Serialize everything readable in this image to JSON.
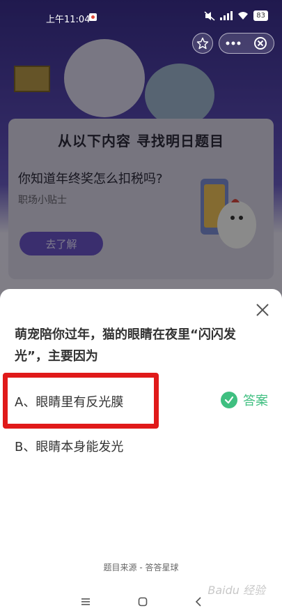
{
  "status": {
    "time": "上午11:04",
    "battery": "83"
  },
  "background": {
    "card_title": "从以下内容 寻找明日题目",
    "tip_question": "你知道年终奖怎么扣税吗?",
    "tip_subtitle": "职场小贴士",
    "learn_button": "去了解"
  },
  "question": {
    "text": "萌宠陪你过年，猫的眼睛在夜里“闪闪发光”，主要因为",
    "option_a": "A、眼睛里有反光膜",
    "option_b": "B、眼睛本身能发光",
    "answer_label": "答案"
  },
  "footer": {
    "source": "题目来源 - 答答星球"
  },
  "watermark": "Baidu 经验",
  "colors": {
    "answer_green": "#3fbf80",
    "highlight_red": "#e01a1a",
    "button_purple": "#6b55c9"
  }
}
